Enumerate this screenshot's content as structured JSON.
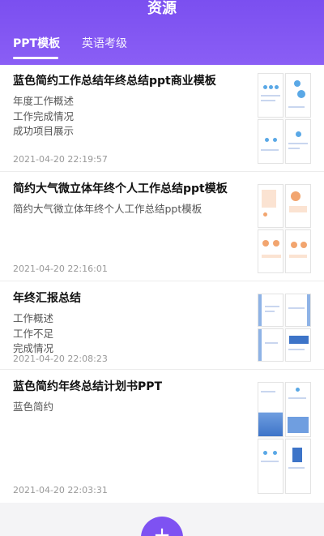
{
  "header": {
    "title": "资源",
    "tabs": [
      {
        "label": "PPT模板",
        "active": true
      },
      {
        "label": "英语考级",
        "active": false
      }
    ]
  },
  "items": [
    {
      "title": "蓝色简约工作总结年终总结ppt商业模板",
      "desc": [
        "年度工作概述",
        "工作完成情况",
        "成功项目展示"
      ],
      "date": "2021-04-20 22:19:57",
      "thumb_style": "blue-dots"
    },
    {
      "title": "简约大气微立体年终个人工作总结ppt模板",
      "desc": [
        "简约大气微立体年终个人工作总结ppt模板"
      ],
      "date": "2021-04-20 22:16:01",
      "thumb_style": "orange"
    },
    {
      "title": "年终汇报总结",
      "desc": [
        "工作概述",
        "工作不足",
        "完成情况"
      ],
      "date": "2021-04-20 22:08:23",
      "thumb_style": "blue-frame"
    },
    {
      "title": "蓝色简约年终总结计划书PPT",
      "desc": [
        "蓝色简约"
      ],
      "date": "2021-04-20 22:03:31",
      "thumb_style": "blue-wave"
    }
  ],
  "fab": {
    "label": "+"
  },
  "colors": {
    "primary": "#7b4ff0",
    "accent": "#5aa8e6",
    "orange": "#f2a56f"
  }
}
